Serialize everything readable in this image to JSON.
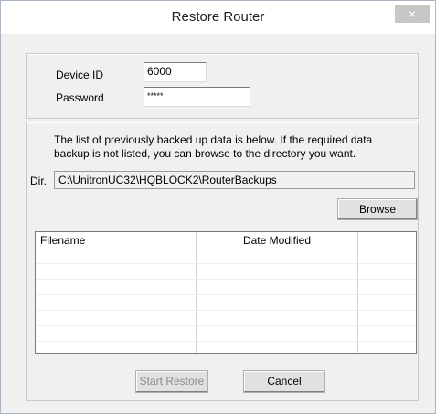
{
  "window": {
    "title": "Restore Router",
    "close_symbol": "×"
  },
  "credentials": {
    "device_id_label": "Device ID",
    "device_id_value": "6000",
    "password_label": "Password",
    "password_value": "*****"
  },
  "backups": {
    "description": "The list of previously backed up data is below. If the required data backup is not listed, you can browse to the directory you want.",
    "dir_label": "Dir.",
    "dir_value": "C:\\UnitronUC32\\HQBLOCK2\\RouterBackups",
    "browse_label": "Browse",
    "columns": [
      "Filename",
      "Date Modified",
      ""
    ],
    "rows": []
  },
  "footer": {
    "start_restore_label": "Start Restore",
    "cancel_label": "Cancel"
  },
  "colors": {
    "title_bar": "#ffffff",
    "dialog_bg": "#f0f0f0",
    "close_button": "#c7c7c7",
    "disabled_text": "#8a8a8a"
  }
}
